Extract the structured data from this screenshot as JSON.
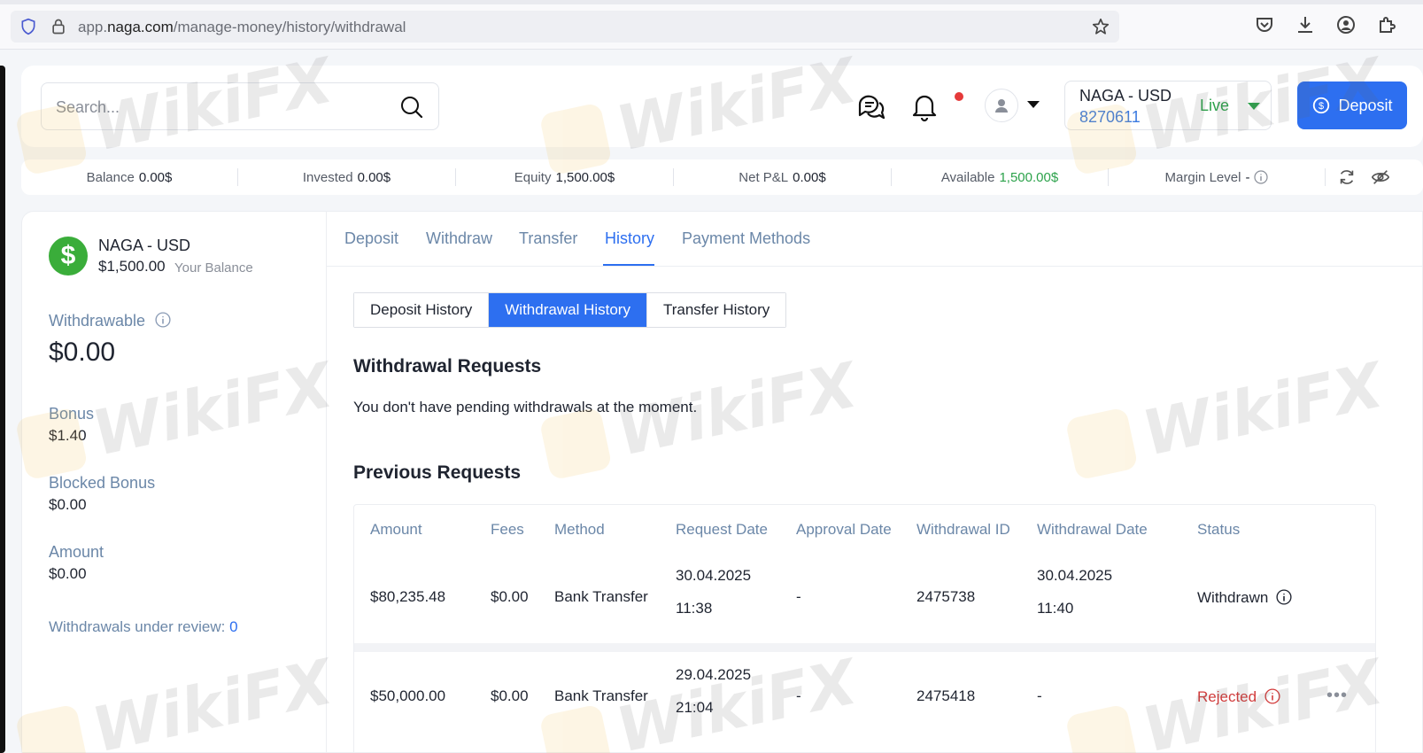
{
  "browser": {
    "url_prefix": "app.",
    "url_domain": "naga.com",
    "url_path": "/manage-money/history/withdrawal"
  },
  "header": {
    "search_placeholder": "Search...",
    "account_name": "NAGA - USD",
    "account_id": "8270611",
    "account_mode": "Live",
    "deposit_label": "Deposit"
  },
  "stats": [
    {
      "label": "Balance",
      "value": "0.00$"
    },
    {
      "label": "Invested",
      "value": "0.00$"
    },
    {
      "label": "Equity",
      "value": "1,500.00$"
    },
    {
      "label": "Net P&L",
      "value": "0.00$"
    },
    {
      "label": "Available",
      "value": "1,500.00$"
    },
    {
      "label": "Margin Level",
      "value": "-"
    }
  ],
  "sidebar": {
    "coin_symbol": "$",
    "account_name": "NAGA - USD",
    "balance": "$1,500.00",
    "balance_label": "Your Balance",
    "withdrawable_label": "Withdrawable",
    "withdrawable_value": "$0.00",
    "bonus_label": "Bonus",
    "bonus_value": "$1.40",
    "blocked_bonus_label": "Blocked Bonus",
    "blocked_bonus_value": "$0.00",
    "amount_label": "Amount",
    "amount_value": "$0.00",
    "review_label": "Withdrawals under review:",
    "review_count": "0"
  },
  "tabs": [
    "Deposit",
    "Withdraw",
    "Transfer",
    "History",
    "Payment Methods"
  ],
  "history_tabs": [
    "Deposit History",
    "Withdrawal History",
    "Transfer History"
  ],
  "withdrawal_requests": {
    "title": "Withdrawal Requests",
    "empty_message": "You don't have pending withdrawals at the moment."
  },
  "previous_requests": {
    "title": "Previous Requests",
    "columns": [
      "Amount",
      "Fees",
      "Method",
      "Request Date",
      "Approval Date",
      "Withdrawal ID",
      "Withdrawal Date",
      "Status"
    ],
    "rows": [
      {
        "amount": "$80,235.48",
        "fees": "$0.00",
        "method": "Bank Transfer",
        "request_date": "30.04.2025",
        "request_time": "11:38",
        "approval_date": "-",
        "withdrawal_id": "2475738",
        "withdrawal_date": "30.04.2025",
        "withdrawal_time": "11:40",
        "status": "Withdrawn"
      },
      {
        "amount": "$50,000.00",
        "fees": "$0.00",
        "method": "Bank Transfer",
        "request_date": "29.04.2025",
        "request_time": "21:04",
        "approval_date": "-",
        "withdrawal_id": "2475418",
        "withdrawal_date": "-",
        "status": "Rejected",
        "more": "•••"
      }
    ]
  },
  "watermark": "WikiFX",
  "colors": {
    "accent": "#2d6ff0",
    "success": "#2ca24b",
    "danger": "#d23b3b",
    "muted_label": "#6b87a8"
  }
}
